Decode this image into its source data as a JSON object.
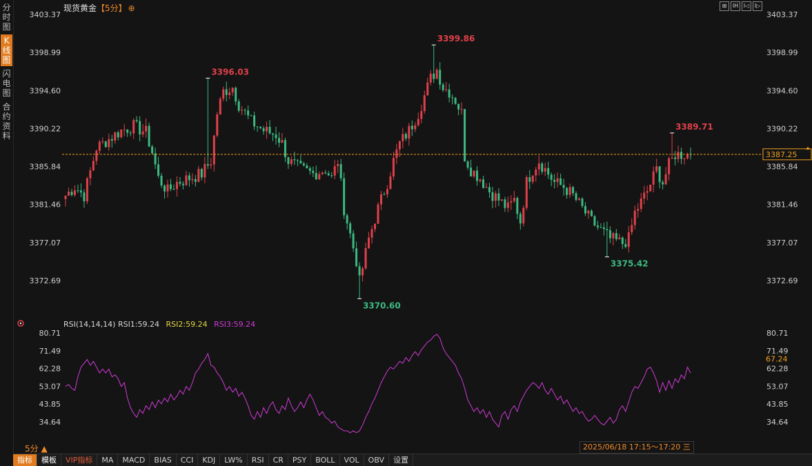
{
  "sidebar": {
    "tabs": [
      "分时图",
      "K线图",
      "闪电图",
      "合约资料"
    ],
    "active": 1
  },
  "header": {
    "title": "现货黄金",
    "timeframe": "【5分】",
    "icon": "plus-circle-icon"
  },
  "window_buttons": [
    "⊞",
    "IH",
    "I◁",
    "I▷"
  ],
  "rsi_legend": {
    "label": "RSI(14,14,14)",
    "rsi1": "RSI1:59.24",
    "rsi2": "RSI2:59.24",
    "rsi3": "RSI3:59.24"
  },
  "period_label": "5分 ▲",
  "time_range": "2025/06/18 17:15～17:20 三",
  "bottom_bar": [
    "指标",
    "模板",
    "VIP指标",
    "MA",
    "MACD",
    "BIAS",
    "CCI",
    "KDJ",
    "LW%",
    "RSI",
    "CR",
    "PSY",
    "BOLL",
    "VOL",
    "OBV",
    "设置"
  ],
  "colors": {
    "up": "#e0414a",
    "down": "#3cba82",
    "rsi": "#d13ad8",
    "accent": "#f08a2a"
  },
  "chart_data": [
    {
      "type": "candlestick",
      "title": "现货黄金",
      "y_ticks": [
        "3403.37",
        "3398.99",
        "3394.60",
        "3390.22",
        "3385.84",
        "3381.46",
        "3377.07",
        "3372.69"
      ],
      "ylim": [
        3370.0,
        3403.37
      ],
      "current_price": "3387.25",
      "annotations": [
        {
          "label": "3396.03",
          "index": 46,
          "value": 3396.03,
          "kind": "high"
        },
        {
          "label": "3399.86",
          "index": 119,
          "value": 3399.86,
          "kind": "high"
        },
        {
          "label": "3370.60",
          "index": 95,
          "value": 3370.6,
          "kind": "low"
        },
        {
          "label": "3375.42",
          "index": 175,
          "value": 3375.42,
          "kind": "low"
        },
        {
          "label": "3389.71",
          "index": 196,
          "value": 3389.71,
          "kind": "high"
        }
      ],
      "anchors": [
        [
          0,
          3382.5
        ],
        [
          3,
          3383.5
        ],
        [
          6,
          3382.5
        ],
        [
          10,
          3388.0
        ],
        [
          14,
          3389.0
        ],
        [
          18,
          3390.0
        ],
        [
          22,
          3390.5
        ],
        [
          26,
          3389.8
        ],
        [
          28,
          3387.5
        ],
        [
          30,
          3384.5
        ],
        [
          33,
          3383.0
        ],
        [
          36,
          3384.0
        ],
        [
          40,
          3384.5
        ],
        [
          44,
          3385.0
        ],
        [
          47,
          3386.5
        ],
        [
          49,
          3392.0
        ],
        [
          51,
          3394.5
        ],
        [
          54,
          3395.0
        ],
        [
          56,
          3393.0
        ],
        [
          60,
          3391.0
        ],
        [
          64,
          3390.0
        ],
        [
          68,
          3389.5
        ],
        [
          70,
          3388.5
        ],
        [
          72,
          3386.5
        ],
        [
          76,
          3385.5
        ],
        [
          80,
          3385.0
        ],
        [
          84,
          3385.5
        ],
        [
          86,
          3384.5
        ],
        [
          88,
          3386.5
        ],
        [
          90,
          3381.0
        ],
        [
          92,
          3378.0
        ],
        [
          94,
          3375.0
        ],
        [
          95,
          3372.5
        ],
        [
          98,
          3377.5
        ],
        [
          101,
          3381.0
        ],
        [
          104,
          3384.0
        ],
        [
          106,
          3386.5
        ],
        [
          108,
          3388.5
        ],
        [
          111,
          3390.0
        ],
        [
          114,
          3392.0
        ],
        [
          116,
          3394.0
        ],
        [
          118,
          3396.0
        ],
        [
          120,
          3397.0
        ],
        [
          122,
          3395.0
        ],
        [
          124,
          3394.5
        ],
        [
          126,
          3393.5
        ],
        [
          128,
          3392.0
        ],
        [
          129,
          3387.0
        ],
        [
          131,
          3385.5
        ],
        [
          134,
          3384.5
        ],
        [
          137,
          3383.0
        ],
        [
          140,
          3382.0
        ],
        [
          143,
          3381.0
        ],
        [
          145,
          3382.0
        ],
        [
          147,
          3379.5
        ],
        [
          149,
          3384.0
        ],
        [
          151,
          3385.5
        ],
        [
          153,
          3386.5
        ],
        [
          155,
          3385.5
        ],
        [
          158,
          3384.0
        ],
        [
          161,
          3383.5
        ],
        [
          164,
          3382.5
        ],
        [
          167,
          3381.0
        ],
        [
          170,
          3379.5
        ],
        [
          173,
          3378.5
        ],
        [
          176,
          3377.5
        ],
        [
          180,
          3377.0
        ],
        [
          182,
          3377.5
        ],
        [
          184,
          3380.5
        ],
        [
          188,
          3383.0
        ],
        [
          191,
          3385.5
        ],
        [
          193,
          3384.0
        ],
        [
          195,
          3386.0
        ],
        [
          197,
          3387.25
        ]
      ],
      "rsi": {
        "y_ticks": [
          "80.71",
          "71.49",
          "62.28",
          "53.07",
          "43.85",
          "34.64"
        ],
        "ylim": [
          28.0,
          82.0
        ],
        "current_value": "67.24",
        "values": [
          {
            "i": 0,
            "v": 53
          },
          {
            "i": 1,
            "v": 54
          },
          {
            "i": 2,
            "v": 52
          },
          {
            "i": 3,
            "v": 51
          },
          {
            "i": 4,
            "v": 58
          },
          {
            "i": 5,
            "v": 63
          },
          {
            "i": 6,
            "v": 65
          },
          {
            "i": 7,
            "v": 67
          },
          {
            "i": 8,
            "v": 64
          },
          {
            "i": 9,
            "v": 66
          },
          {
            "i": 10,
            "v": 63
          },
          {
            "i": 11,
            "v": 60
          },
          {
            "i": 12,
            "v": 62
          },
          {
            "i": 13,
            "v": 60
          },
          {
            "i": 14,
            "v": 62
          },
          {
            "i": 15,
            "v": 58
          },
          {
            "i": 16,
            "v": 59
          },
          {
            "i": 17,
            "v": 57
          },
          {
            "i": 18,
            "v": 53
          },
          {
            "i": 19,
            "v": 55
          },
          {
            "i": 20,
            "v": 47
          },
          {
            "i": 21,
            "v": 42
          },
          {
            "i": 22,
            "v": 39
          },
          {
            "i": 23,
            "v": 37
          },
          {
            "i": 24,
            "v": 41
          },
          {
            "i": 25,
            "v": 39
          },
          {
            "i": 26,
            "v": 43
          },
          {
            "i": 27,
            "v": 41
          },
          {
            "i": 28,
            "v": 45
          },
          {
            "i": 29,
            "v": 42
          },
          {
            "i": 30,
            "v": 46
          },
          {
            "i": 31,
            "v": 44
          },
          {
            "i": 32,
            "v": 47
          },
          {
            "i": 33,
            "v": 45
          },
          {
            "i": 34,
            "v": 49
          },
          {
            "i": 35,
            "v": 46
          },
          {
            "i": 36,
            "v": 48
          },
          {
            "i": 37,
            "v": 51
          },
          {
            "i": 38,
            "v": 49
          },
          {
            "i": 39,
            "v": 53
          },
          {
            "i": 40,
            "v": 51
          },
          {
            "i": 41,
            "v": 55
          },
          {
            "i": 42,
            "v": 60
          },
          {
            "i": 43,
            "v": 62
          },
          {
            "i": 44,
            "v": 65
          },
          {
            "i": 45,
            "v": 67
          },
          {
            "i": 46,
            "v": 70
          },
          {
            "i": 47,
            "v": 64
          },
          {
            "i": 48,
            "v": 63
          },
          {
            "i": 49,
            "v": 60
          },
          {
            "i": 50,
            "v": 58
          },
          {
            "i": 51,
            "v": 55
          },
          {
            "i": 52,
            "v": 51
          },
          {
            "i": 53,
            "v": 53
          },
          {
            "i": 54,
            "v": 50
          },
          {
            "i": 55,
            "v": 52
          },
          {
            "i": 56,
            "v": 48
          },
          {
            "i": 57,
            "v": 50
          },
          {
            "i": 58,
            "v": 47
          },
          {
            "i": 59,
            "v": 43
          },
          {
            "i": 60,
            "v": 38
          },
          {
            "i": 61,
            "v": 36
          },
          {
            "i": 62,
            "v": 40
          },
          {
            "i": 63,
            "v": 37
          },
          {
            "i": 64,
            "v": 42
          },
          {
            "i": 65,
            "v": 39
          },
          {
            "i": 66,
            "v": 43
          },
          {
            "i": 67,
            "v": 45
          },
          {
            "i": 68,
            "v": 41
          },
          {
            "i": 69,
            "v": 39
          },
          {
            "i": 70,
            "v": 43
          },
          {
            "i": 71,
            "v": 41
          },
          {
            "i": 72,
            "v": 47
          },
          {
            "i": 73,
            "v": 43
          },
          {
            "i": 74,
            "v": 40
          },
          {
            "i": 75,
            "v": 42
          },
          {
            "i": 76,
            "v": 45
          },
          {
            "i": 77,
            "v": 42
          },
          {
            "i": 78,
            "v": 46
          },
          {
            "i": 79,
            "v": 49
          },
          {
            "i": 80,
            "v": 46
          },
          {
            "i": 81,
            "v": 42
          },
          {
            "i": 82,
            "v": 38
          },
          {
            "i": 83,
            "v": 40
          },
          {
            "i": 84,
            "v": 37
          },
          {
            "i": 85,
            "v": 36
          },
          {
            "i": 86,
            "v": 34
          },
          {
            "i": 87,
            "v": 35
          },
          {
            "i": 88,
            "v": 32
          },
          {
            "i": 89,
            "v": 31
          },
          {
            "i": 90,
            "v": 30
          },
          {
            "i": 91,
            "v": 30
          },
          {
            "i": 92,
            "v": 29
          },
          {
            "i": 93,
            "v": 30
          },
          {
            "i": 94,
            "v": 29
          },
          {
            "i": 95,
            "v": 30
          },
          {
            "i": 96,
            "v": 33
          },
          {
            "i": 97,
            "v": 37
          },
          {
            "i": 98,
            "v": 40
          },
          {
            "i": 99,
            "v": 44
          },
          {
            "i": 100,
            "v": 47
          },
          {
            "i": 101,
            "v": 51
          },
          {
            "i": 102,
            "v": 55
          },
          {
            "i": 103,
            "v": 58
          },
          {
            "i": 104,
            "v": 61
          },
          {
            "i": 105,
            "v": 63
          },
          {
            "i": 106,
            "v": 62
          },
          {
            "i": 107,
            "v": 64
          },
          {
            "i": 108,
            "v": 66
          },
          {
            "i": 109,
            "v": 65
          },
          {
            "i": 110,
            "v": 68
          },
          {
            "i": 111,
            "v": 66
          },
          {
            "i": 112,
            "v": 69
          },
          {
            "i": 113,
            "v": 71
          },
          {
            "i": 114,
            "v": 69
          },
          {
            "i": 115,
            "v": 72
          },
          {
            "i": 116,
            "v": 74
          },
          {
            "i": 117,
            "v": 76
          },
          {
            "i": 118,
            "v": 77
          },
          {
            "i": 119,
            "v": 79
          },
          {
            "i": 120,
            "v": 80
          },
          {
            "i": 121,
            "v": 78
          },
          {
            "i": 122,
            "v": 73
          },
          {
            "i": 123,
            "v": 70
          },
          {
            "i": 124,
            "v": 68
          },
          {
            "i": 125,
            "v": 66
          },
          {
            "i": 126,
            "v": 64
          },
          {
            "i": 127,
            "v": 60
          },
          {
            "i": 128,
            "v": 57
          },
          {
            "i": 129,
            "v": 52
          },
          {
            "i": 130,
            "v": 46
          },
          {
            "i": 131,
            "v": 43
          },
          {
            "i": 132,
            "v": 40
          },
          {
            "i": 133,
            "v": 42
          },
          {
            "i": 134,
            "v": 39
          },
          {
            "i": 135,
            "v": 41
          },
          {
            "i": 136,
            "v": 37
          },
          {
            "i": 137,
            "v": 40
          },
          {
            "i": 138,
            "v": 36
          },
          {
            "i": 139,
            "v": 34
          },
          {
            "i": 140,
            "v": 32
          },
          {
            "i": 141,
            "v": 38
          },
          {
            "i": 142,
            "v": 40
          },
          {
            "i": 143,
            "v": 36
          },
          {
            "i": 144,
            "v": 41
          },
          {
            "i": 145,
            "v": 43
          },
          {
            "i": 146,
            "v": 40
          },
          {
            "i": 147,
            "v": 45
          },
          {
            "i": 148,
            "v": 48
          },
          {
            "i": 149,
            "v": 51
          },
          {
            "i": 150,
            "v": 53
          },
          {
            "i": 151,
            "v": 55
          },
          {
            "i": 152,
            "v": 54
          },
          {
            "i": 153,
            "v": 52
          },
          {
            "i": 154,
            "v": 55
          },
          {
            "i": 155,
            "v": 51
          },
          {
            "i": 156,
            "v": 49
          },
          {
            "i": 157,
            "v": 52
          },
          {
            "i": 158,
            "v": 49
          },
          {
            "i": 159,
            "v": 46
          },
          {
            "i": 160,
            "v": 48
          },
          {
            "i": 161,
            "v": 44
          },
          {
            "i": 162,
            "v": 46
          },
          {
            "i": 163,
            "v": 43
          },
          {
            "i": 164,
            "v": 40
          },
          {
            "i": 165,
            "v": 42
          },
          {
            "i": 166,
            "v": 39
          },
          {
            "i": 167,
            "v": 40
          },
          {
            "i": 168,
            "v": 37
          },
          {
            "i": 169,
            "v": 35
          },
          {
            "i": 170,
            "v": 36
          },
          {
            "i": 171,
            "v": 38
          },
          {
            "i": 172,
            "v": 36
          },
          {
            "i": 173,
            "v": 34
          },
          {
            "i": 174,
            "v": 33
          },
          {
            "i": 175,
            "v": 35
          },
          {
            "i": 176,
            "v": 37
          },
          {
            "i": 177,
            "v": 34
          },
          {
            "i": 178,
            "v": 36
          },
          {
            "i": 179,
            "v": 41
          },
          {
            "i": 180,
            "v": 43
          },
          {
            "i": 181,
            "v": 40
          },
          {
            "i": 182,
            "v": 45
          },
          {
            "i": 183,
            "v": 50
          },
          {
            "i": 184,
            "v": 53
          },
          {
            "i": 185,
            "v": 52
          },
          {
            "i": 186,
            "v": 55
          },
          {
            "i": 187,
            "v": 58
          },
          {
            "i": 188,
            "v": 62
          },
          {
            "i": 189,
            "v": 63
          },
          {
            "i": 190,
            "v": 60
          },
          {
            "i": 191,
            "v": 56
          },
          {
            "i": 192,
            "v": 50
          },
          {
            "i": 193,
            "v": 55
          },
          {
            "i": 194,
            "v": 51
          },
          {
            "i": 195,
            "v": 56
          },
          {
            "i": 196,
            "v": 52
          },
          {
            "i": 197,
            "v": 57
          },
          {
            "i": 198,
            "v": 55
          },
          {
            "i": 199,
            "v": 59
          },
          {
            "i": 200,
            "v": 57
          },
          {
            "i": 201,
            "v": 63
          },
          {
            "i": 202,
            "v": 60
          }
        ]
      }
    }
  ]
}
